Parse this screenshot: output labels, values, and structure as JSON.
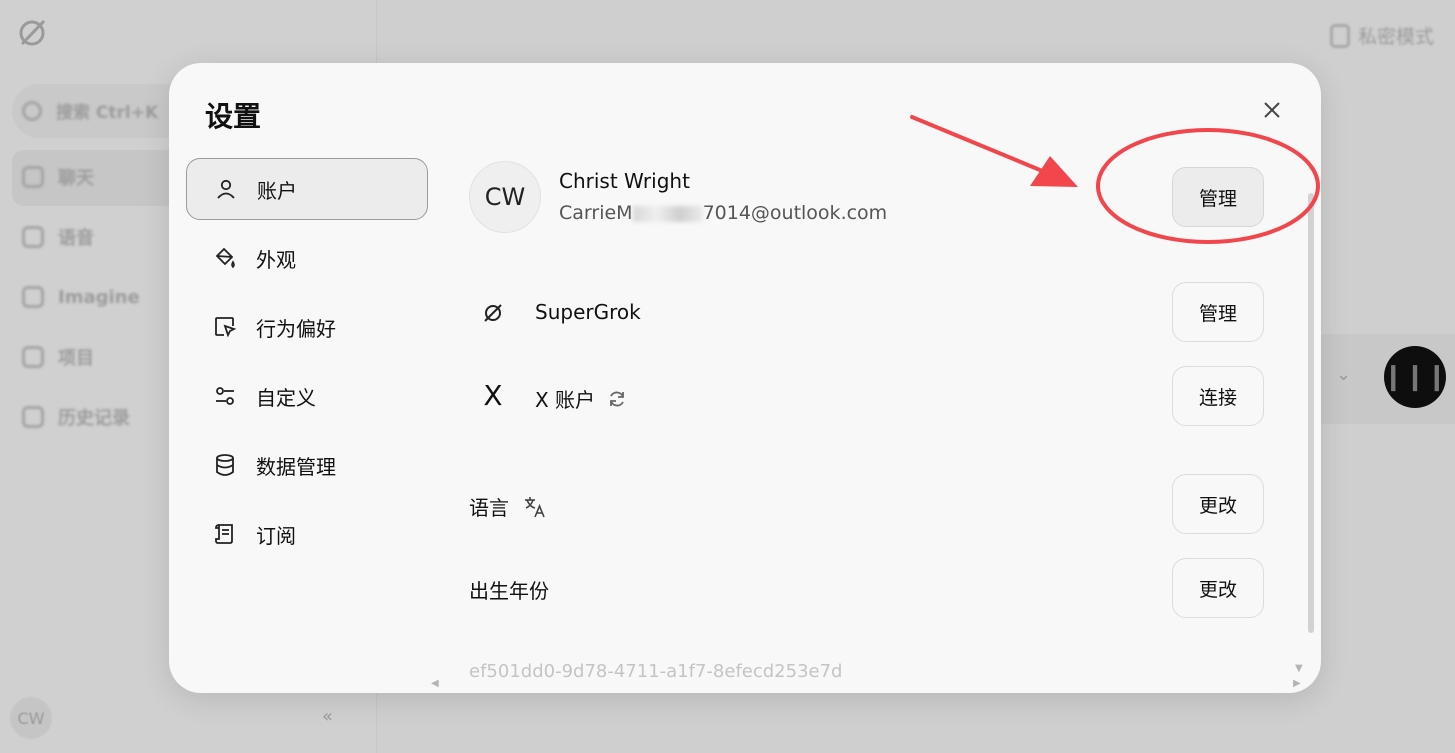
{
  "background": {
    "search_label": "搜索 Ctrl+K",
    "sidebar_items": [
      {
        "label": "聊天",
        "icon": "edit-icon"
      },
      {
        "label": "语音",
        "icon": "voice-icon"
      },
      {
        "label": "Imagine",
        "icon": "image-icon"
      },
      {
        "label": "项目",
        "icon": "folder-icon"
      },
      {
        "label": "历史记录",
        "icon": "history-icon"
      }
    ],
    "private_mode": "私密模式",
    "user_initials": "CW"
  },
  "modal": {
    "title": "设置",
    "nav": [
      {
        "label": "账户",
        "icon": "user-icon",
        "active": true
      },
      {
        "label": "外观",
        "icon": "paint-bucket-icon"
      },
      {
        "label": "行为偏好",
        "icon": "cursor-window-icon"
      },
      {
        "label": "自定义",
        "icon": "sliders-icon"
      },
      {
        "label": "数据管理",
        "icon": "database-icon"
      },
      {
        "label": "订阅",
        "icon": "scroll-icon"
      }
    ],
    "account": {
      "initials": "CW",
      "name": "Christ Wright",
      "email_prefix": "CarrieM",
      "email_suffix": "7014@outlook.com",
      "manage_label": "管理"
    },
    "supergrok": {
      "label": "SuperGrok",
      "button": "管理"
    },
    "x_account": {
      "icon_glyph": "X",
      "label": "X 账户",
      "button": "连接"
    },
    "language": {
      "label": "语言",
      "button": "更改"
    },
    "birth_year": {
      "label": "出生年份",
      "button": "更改"
    },
    "user_id": "ef501dd0-9d78-4711-a1f7-8efecd253e7d"
  },
  "colors": {
    "annotation_red": "#f0464c",
    "modal_bg": "#f8f8f8",
    "backdrop": "#cfcfcf"
  }
}
